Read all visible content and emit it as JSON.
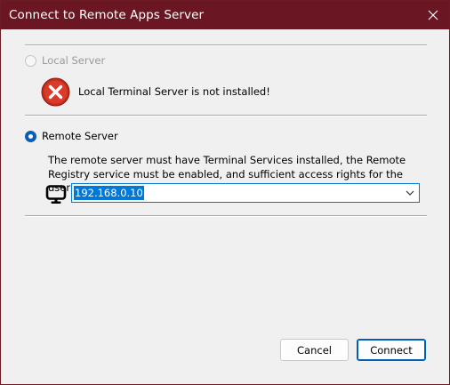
{
  "window": {
    "title": "Connect to Remote Apps Server",
    "close_icon": "close-icon"
  },
  "local": {
    "label": "Local Server",
    "selected": false,
    "enabled": false,
    "error_icon": "error-icon",
    "error_message": "Local Terminal Server is not installed!"
  },
  "remote": {
    "label": "Remote Server",
    "selected": true,
    "description": "The remote server must have Terminal Services installed, the Remote Registry service must be enabled, and sufficient access rights for the user needs.",
    "server_icon": "monitor-icon",
    "server_value": "192.168.0.10",
    "dropdown_icon": "chevron-down-icon"
  },
  "buttons": {
    "cancel": "Cancel",
    "connect": "Connect"
  },
  "colors": {
    "titlebar": "#6b1623",
    "accent": "#0078d7",
    "error": "#c42b1c"
  }
}
